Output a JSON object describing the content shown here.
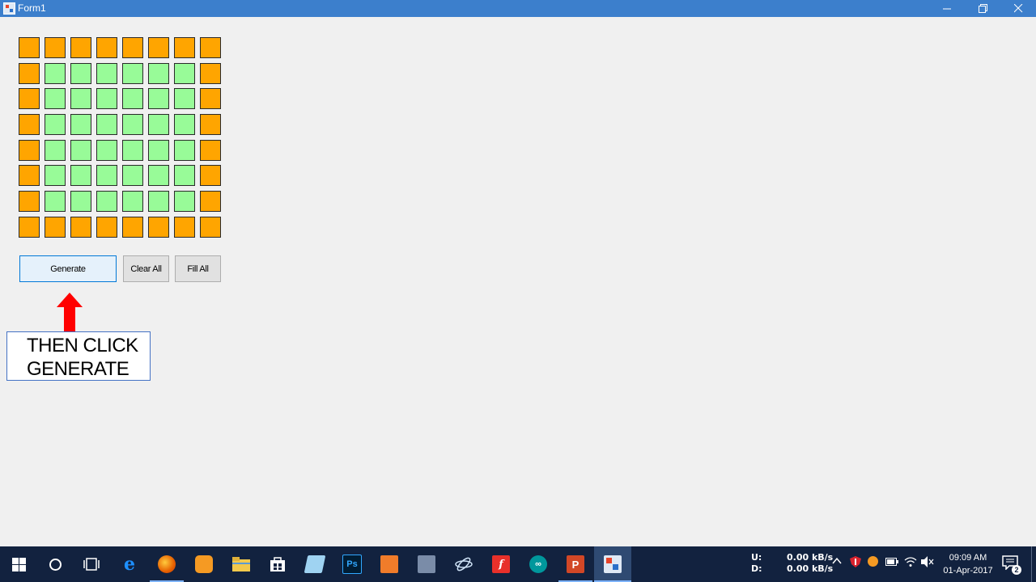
{
  "window": {
    "title": "Form1",
    "controls": [
      "minimize-icon",
      "restore-icon",
      "close-icon"
    ]
  },
  "grid": {
    "rows": 8,
    "cols": 8,
    "colors": {
      "border_cell": "#ffa500",
      "inner_cell": "#98fb98"
    }
  },
  "buttons": {
    "generate": "Generate",
    "clear_all": "Clear All",
    "fill_all": "Fill All"
  },
  "annotation": {
    "line1": "THEN CLICK",
    "line2": "GENERATE",
    "arrow_color": "#ff0000"
  },
  "taskbar": {
    "apps": [
      "windows-start-icon",
      "search-icon",
      "task-view-icon",
      "edge-icon",
      "firefox-icon",
      "uc-browser-icon",
      "file-explorer-icon",
      "store-icon",
      "app-icon",
      "photoshop-icon",
      "app-icon",
      "app-icon",
      "app-icon",
      "foxit-icon",
      "arduino-icon",
      "powerpoint-icon",
      "form-app-icon"
    ],
    "network": {
      "up_label": "U:",
      "up_speed": "0.00 kB/s",
      "down_label": "D:",
      "down_speed": "0.00 kB/s"
    },
    "clock": {
      "time": "09:09 AM",
      "date": "01-Apr-2017"
    },
    "notifications": "2"
  }
}
